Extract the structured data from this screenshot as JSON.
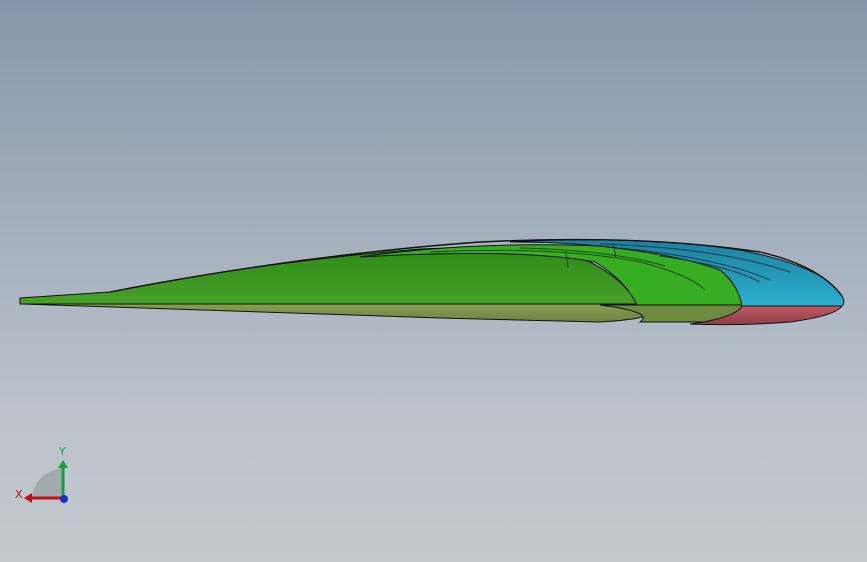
{
  "viewport": {
    "background_top": "#8796aa",
    "background_bottom": "#c4c9cf"
  },
  "model": {
    "colors": {
      "trailing_section": "#3a8f1d",
      "mid_section": "#33b01f",
      "leading_edge_top": "#2aa2c0",
      "leading_edge_bottom": "#b0505a",
      "lower_surface": "#7d9250",
      "edge": "#111111"
    }
  },
  "triad": {
    "x_label": "X",
    "y_label": "Y",
    "x_color": "#c01010",
    "y_color": "#16a03a",
    "z_color": "#1a2fd0"
  }
}
